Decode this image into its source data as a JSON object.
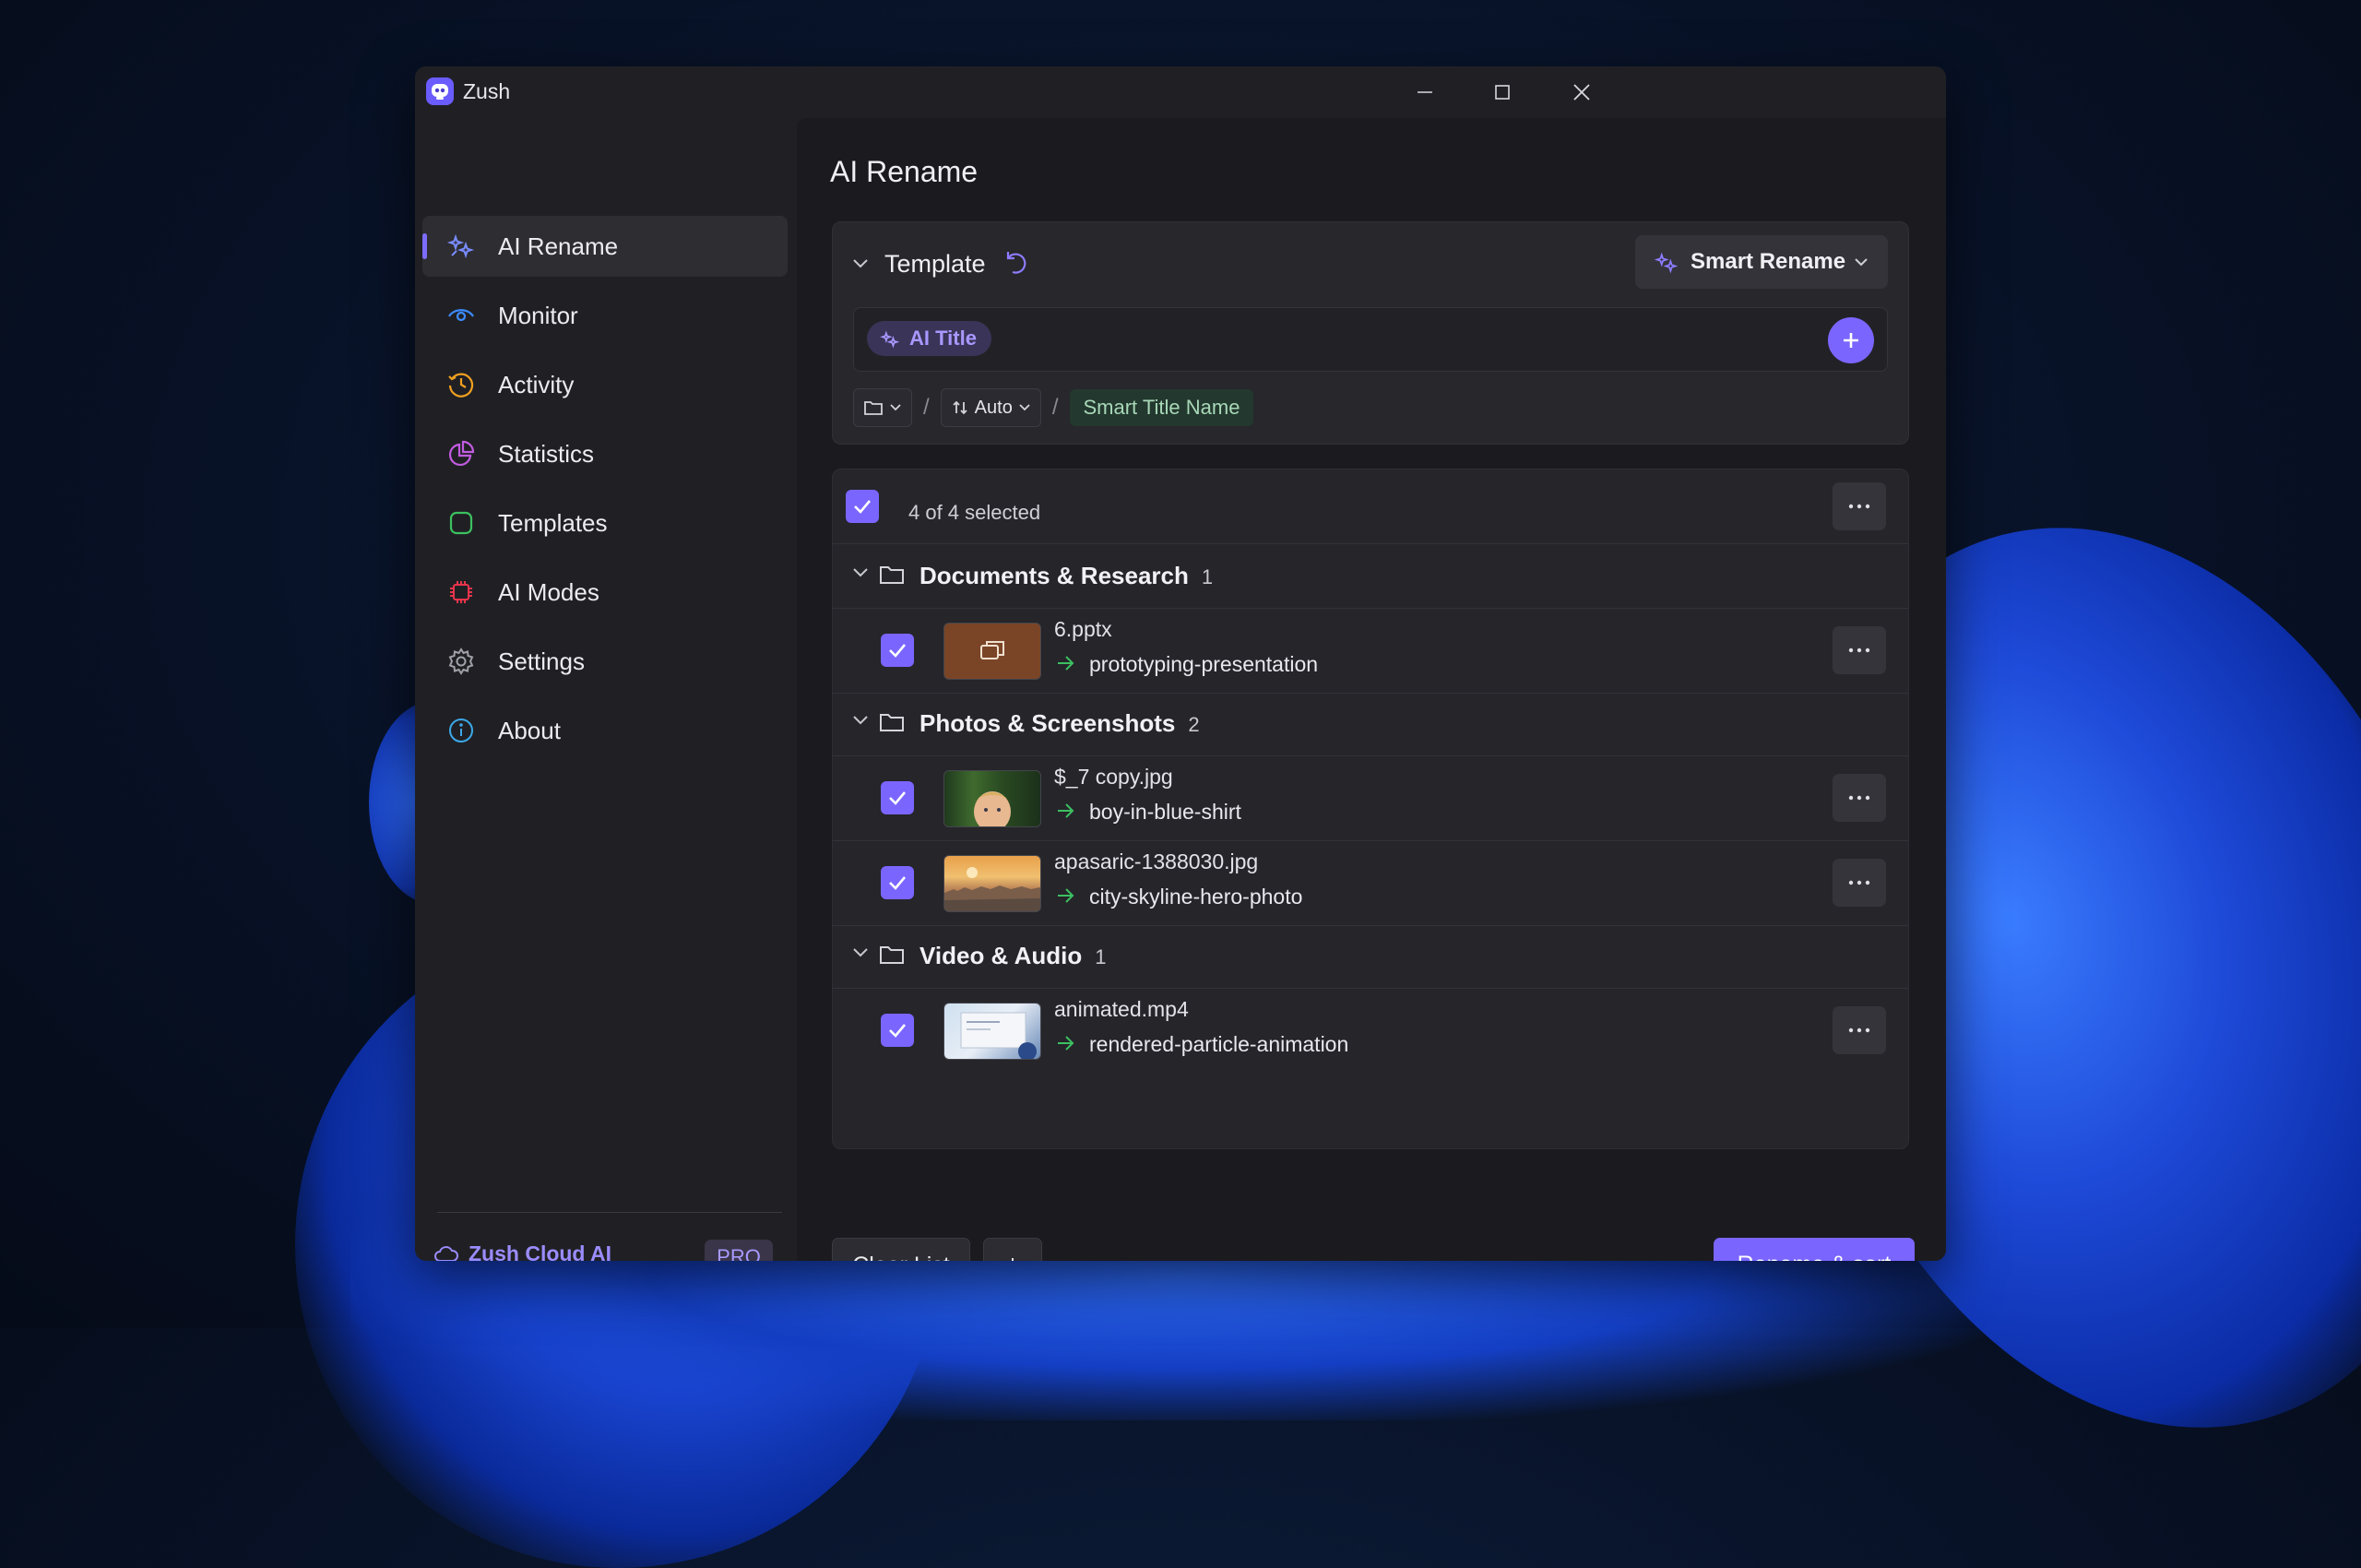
{
  "app": {
    "title": "Zush",
    "accent": "#7a66ff"
  },
  "sidebar": {
    "items": [
      {
        "label": "AI Rename",
        "icon": "sparkle-icon",
        "color": "#7a66ff"
      },
      {
        "label": "Monitor",
        "icon": "eye-icon",
        "color": "#3d8bff"
      },
      {
        "label": "Activity",
        "icon": "history-icon",
        "color": "#f0a020"
      },
      {
        "label": "Statistics",
        "icon": "pie-chart-icon",
        "color": "#c25ce0"
      },
      {
        "label": "Templates",
        "icon": "template-icon",
        "color": "#3cc060"
      },
      {
        "label": "AI Modes",
        "icon": "chip-icon",
        "color": "#e8344c"
      },
      {
        "label": "Settings",
        "icon": "gear-icon",
        "color": "#a0a0a8"
      },
      {
        "label": "About",
        "icon": "info-icon",
        "color": "#3ca8e8"
      }
    ],
    "cloud_label": "Zush Cloud AI",
    "pro_badge": "PRO"
  },
  "main": {
    "title": "AI Rename",
    "template": {
      "label": "Template",
      "mode_button": "Smart Rename",
      "chip": "AI Title",
      "path_auto": "Auto",
      "path_sep": "/",
      "name_chip": "Smart Title Name"
    },
    "selection": {
      "text": "4 of 4 selected"
    },
    "groups": [
      {
        "name": "Documents & Research",
        "count": "1",
        "files": [
          {
            "original": "6.pptx",
            "renamed": "prototyping-presentation",
            "thumb": "pptx"
          }
        ]
      },
      {
        "name": "Photos & Screenshots",
        "count": "2",
        "files": [
          {
            "original": "$_7 copy.jpg",
            "renamed": "boy-in-blue-shirt",
            "thumb": "photo-boy"
          },
          {
            "original": "apasaric-1388030.jpg",
            "renamed": "city-skyline-hero-photo",
            "thumb": "photo-city"
          }
        ]
      },
      {
        "name": "Video & Audio",
        "count": "1",
        "files": [
          {
            "original": "animated.mp4",
            "renamed": "rendered-particle-animation",
            "thumb": "video"
          }
        ]
      }
    ],
    "buttons": {
      "clear": "Clear List",
      "rename": "Rename & sort"
    }
  }
}
